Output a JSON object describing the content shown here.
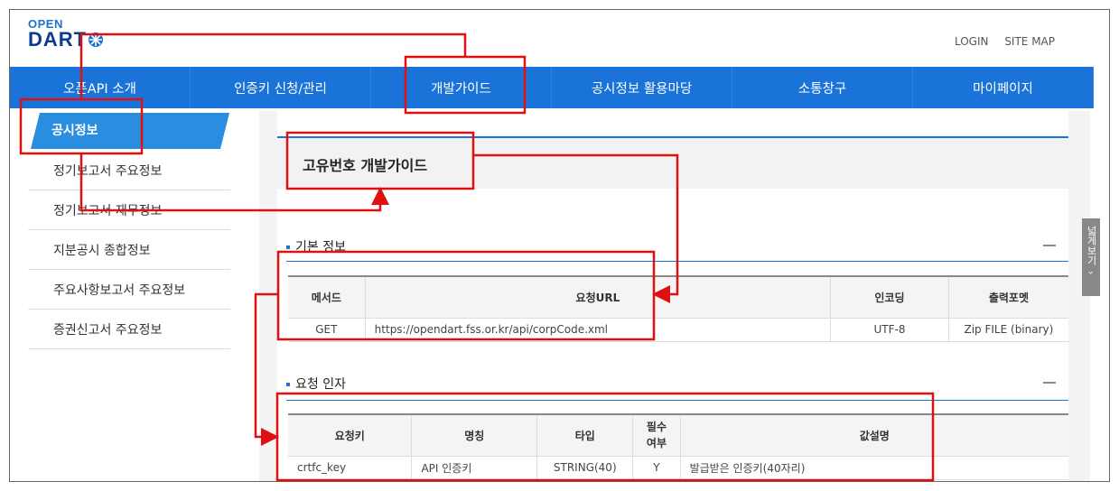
{
  "logo": {
    "top": "OPEN",
    "bottom": "DART"
  },
  "util": {
    "login": "LOGIN",
    "sitemap": "SITE MAP"
  },
  "nav": [
    "오픈API 소개",
    "인증키 신청/관리",
    "개발가이드",
    "공시정보 활용마당",
    "소통창구",
    "마이페이지"
  ],
  "sidebar": {
    "active": "공시정보",
    "items": [
      "정기보고서 주요정보",
      "정기보고서 재무정보",
      "지분공시 종합정보",
      "주요사항보고서 주요정보",
      "증권신고서 주요정보"
    ]
  },
  "page_title": "고유번호 개발가이드",
  "section1": {
    "title": "기본 정보",
    "headers": [
      "메서드",
      "요청URL",
      "인코딩",
      "출력포멧"
    ],
    "row": [
      "GET",
      "https://opendart.fss.or.kr/api/corpCode.xml",
      "UTF-8",
      "Zip FILE (binary)"
    ]
  },
  "section2": {
    "title": "요청 인자",
    "headers": [
      "요청키",
      "명칭",
      "타입",
      "필수\n여부",
      "값설명"
    ],
    "header_required_1": "필수",
    "header_required_2": "여부",
    "row": [
      "crtfc_key",
      "API 인증키",
      "STRING(40)",
      "Y",
      "발급받은 인증키(40자리)"
    ]
  },
  "wide_view": {
    "label": "넓게보기",
    "arrow": "›"
  },
  "colors": {
    "nav_blue": "#1a73d9",
    "annotation_red": "#e01010",
    "dart_navy": "#0b3d8c"
  }
}
